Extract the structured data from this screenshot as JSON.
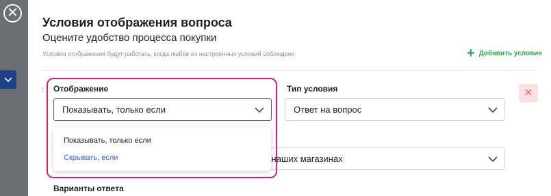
{
  "modal": {
    "close_icon": "close-circle-icon",
    "title": "Условия отображения вопроса",
    "subtitle": "Оцените удобство процесса покупки",
    "note": "Условия отображения будут работать, когда любое из настроенных условий соблюдено",
    "add_condition_label": "Добавить условие",
    "add_color": "#27a844"
  },
  "condition": {
    "display_label": "Отображение",
    "display_value": "Показывать, только если",
    "type_label": "Тип условия",
    "type_value": "Ответ на вопрос",
    "question_value_partial": "в наших магазинах",
    "answers_label": "Варианты ответа",
    "delete_icon": "close-icon",
    "highlight_color": "#d81b77"
  },
  "dropdown": {
    "options": [
      "Показывать, только если",
      "Скрывать, если"
    ]
  }
}
